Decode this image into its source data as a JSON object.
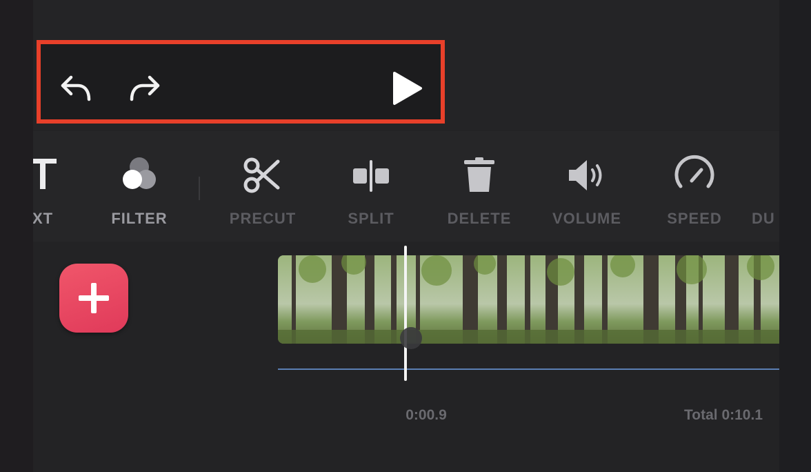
{
  "controls": {
    "undo": "undo-icon",
    "redo": "redo-icon",
    "play": "play-icon"
  },
  "toolbar": {
    "items": [
      {
        "label": "XT",
        "icon": "text-icon"
      },
      {
        "label": "FILTER",
        "icon": "filter-icon"
      },
      {
        "label": "PRECUT",
        "icon": "scissors-icon"
      },
      {
        "label": "SPLIT",
        "icon": "split-icon"
      },
      {
        "label": "DELETE",
        "icon": "trash-icon"
      },
      {
        "label": "VOLUME",
        "icon": "volume-icon"
      },
      {
        "label": "SPEED",
        "icon": "speedometer-icon"
      },
      {
        "label": "DU",
        "icon": "duplicate-icon"
      }
    ]
  },
  "timeline": {
    "add_icon": "plus-icon",
    "current_time": "0:00.9",
    "total_time": "Total 0:10.1"
  },
  "colors": {
    "highlight": "#e8402a",
    "add_button": "#eb4a63",
    "audio_line": "#5b7fb4"
  }
}
